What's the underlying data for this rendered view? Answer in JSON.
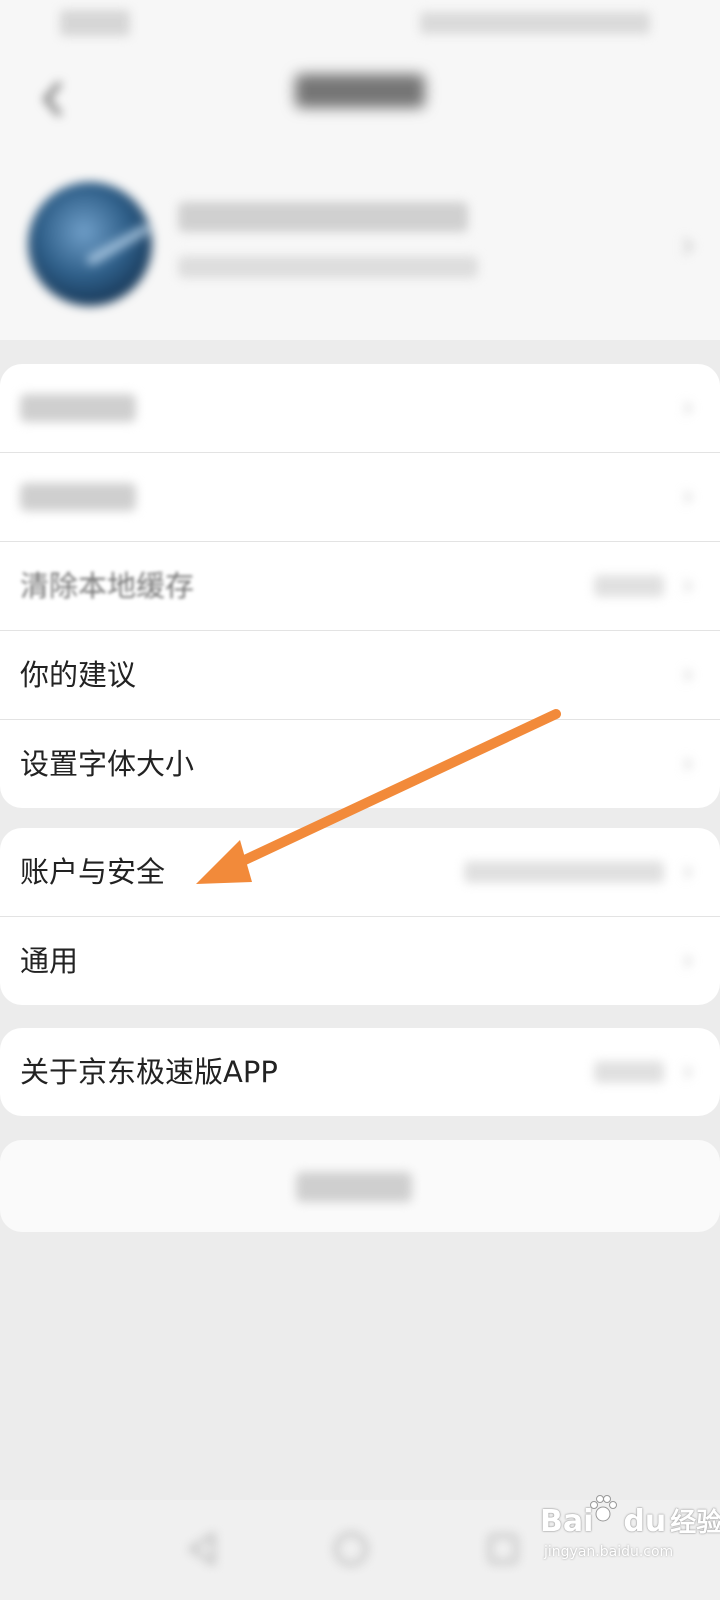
{
  "menu": {
    "rows": [
      {
        "label": "清除本地缓存"
      },
      {
        "label": "你的建议"
      },
      {
        "label": "设置字体大小"
      },
      {
        "label": "账户与安全"
      },
      {
        "label": "通用"
      },
      {
        "label": "关于京东极速版APP"
      }
    ]
  },
  "annotation": {
    "color": "#f28a3a",
    "target": "账户与安全"
  },
  "watermark": {
    "brand": "Bai",
    "brand2": "du",
    "suffix": "经验",
    "sub": "jingyan.baidu.com"
  },
  "icons": {
    "back": "chevron-left-icon",
    "row": "chevron-right-icon",
    "nav_back": "triangle-back-icon",
    "nav_home": "circle-home-icon",
    "nav_recent": "square-recent-icon"
  }
}
